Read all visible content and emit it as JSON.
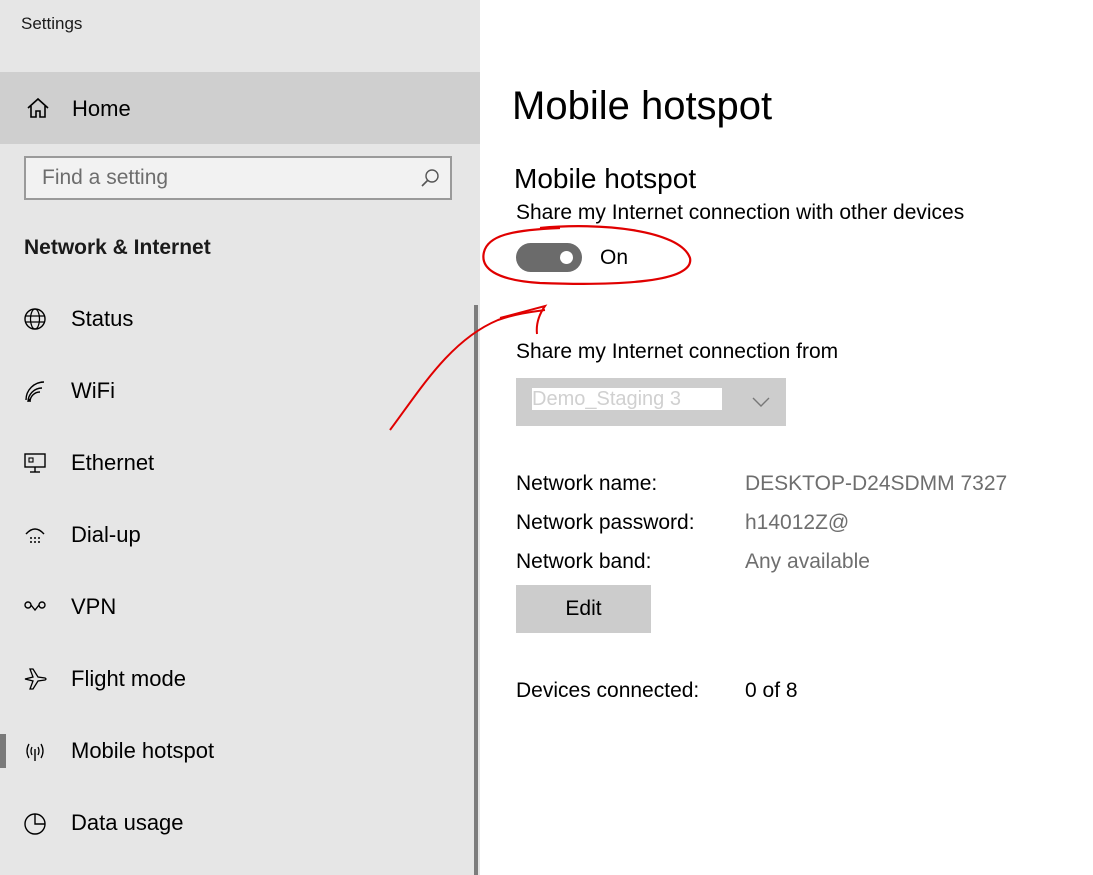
{
  "app": {
    "title": "Settings"
  },
  "sidebar": {
    "home_label": "Home",
    "search": {
      "placeholder": "Find a setting",
      "value": ""
    },
    "section_title": "Network & Internet",
    "items": [
      {
        "label": "Status",
        "icon": "globe-icon"
      },
      {
        "label": "WiFi",
        "icon": "wifi-icon"
      },
      {
        "label": "Ethernet",
        "icon": "ethernet-icon"
      },
      {
        "label": "Dial-up",
        "icon": "dialup-icon"
      },
      {
        "label": "VPN",
        "icon": "vpn-icon"
      },
      {
        "label": "Flight mode",
        "icon": "airplane-icon"
      },
      {
        "label": "Mobile hotspot",
        "icon": "hotspot-icon",
        "selected": true
      },
      {
        "label": "Data usage",
        "icon": "data-usage-icon"
      }
    ]
  },
  "main": {
    "page_title": "Mobile hotspot",
    "section_title": "Mobile hotspot",
    "share_description": "Share my Internet connection with other devices",
    "toggle": {
      "state_label": "On",
      "on": true
    },
    "share_from_label": "Share my Internet connection from",
    "share_from_value": "Demo_Staging 3",
    "network_name_label": "Network name:",
    "network_name_value": "DESKTOP-D24SDMM 7327",
    "network_password_label": "Network password:",
    "network_password_value": "h14012Z@",
    "network_band_label": "Network band:",
    "network_band_value": "Any available",
    "edit_label": "Edit",
    "devices_connected_label": "Devices connected:",
    "devices_connected_value": "0 of 8"
  },
  "colors": {
    "sidebar_bg": "#e6e6e6",
    "home_bg": "#cfcfcf",
    "toggle_bg": "#6b6b6b",
    "annotation": "#e00000"
  }
}
